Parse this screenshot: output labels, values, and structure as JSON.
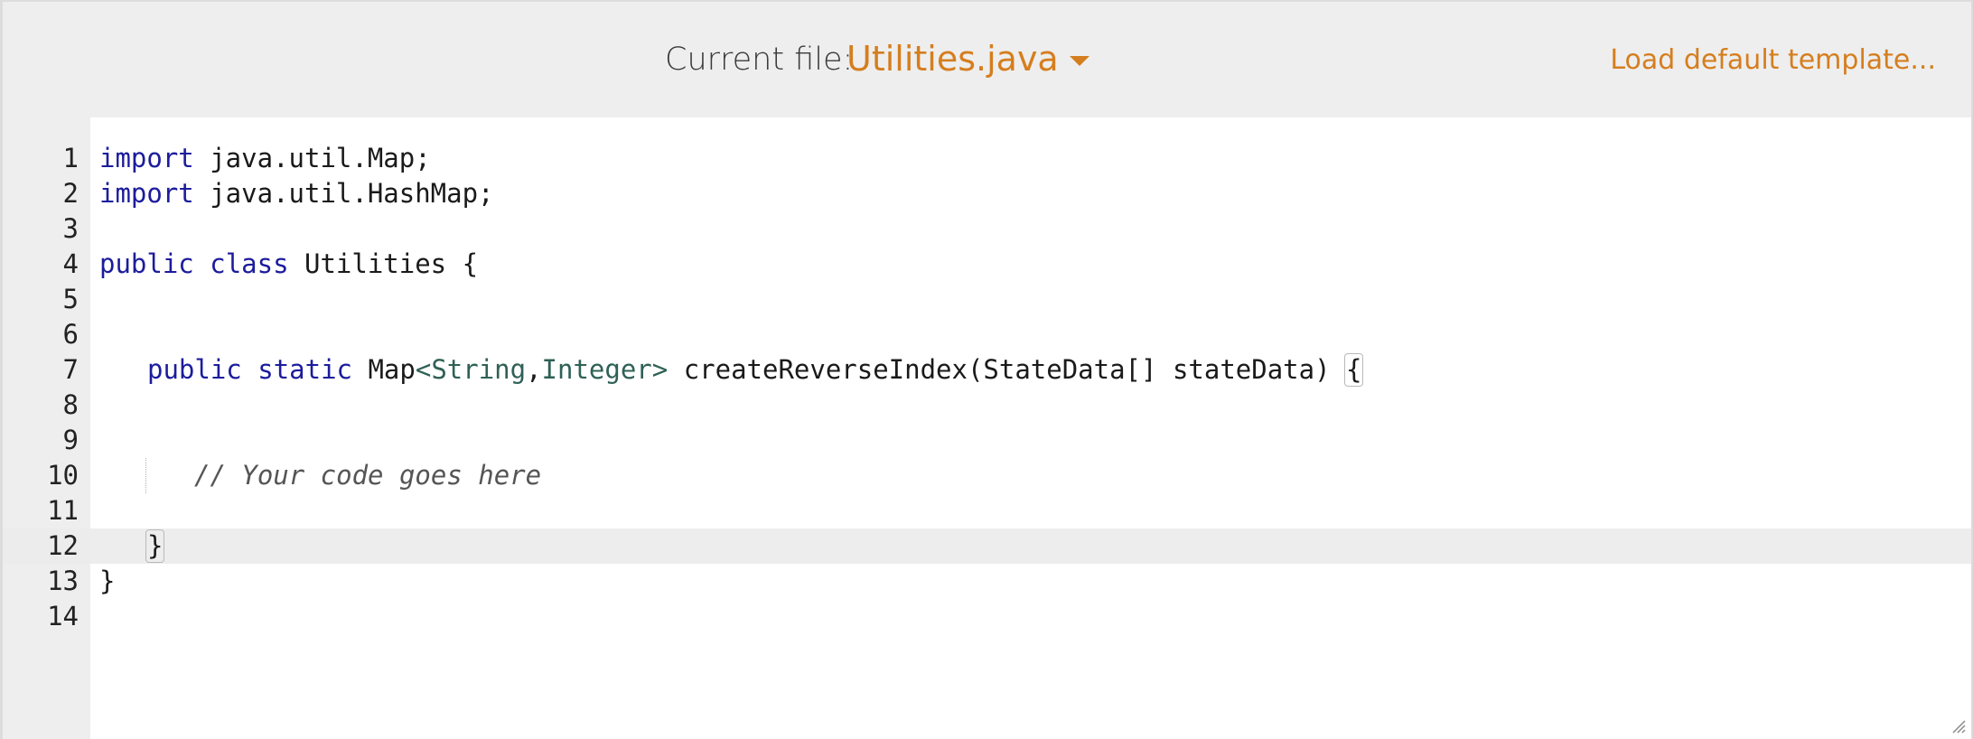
{
  "header": {
    "current_file_label": "Current file:",
    "file_name": "Utilities.java",
    "load_template_label": "Load default template..."
  },
  "editor": {
    "active_line": 12,
    "line_numbers": [
      "1",
      "2",
      "3",
      "4",
      "5",
      "6",
      "7",
      "8",
      "9",
      "10",
      "11",
      "12",
      "13",
      "14"
    ],
    "lines": {
      "l1_kw": "import",
      "l1_rest": " java.util.Map;",
      "l2_kw": "import",
      "l2_rest": " java.util.HashMap;",
      "l4_kw1": "public",
      "l4_kw2": "class",
      "l4_rest": " Utilities {",
      "l7_kw1": "public",
      "l7_kw2": "static",
      "l7_map": " Map",
      "l7_lt": "<",
      "l7_t1": "String",
      "l7_comma": ",",
      "l7_t2": "Integer",
      "l7_gt": ">",
      "l7_rest": " createReverseIndex(StateData[] stateData) ",
      "l7_brace": "{",
      "l10_comment": "// Your code goes here",
      "l12_brace": "}",
      "l13_brace": "}"
    }
  },
  "colors": {
    "accent": "#d57e1e",
    "keyword": "#1c1c9c",
    "type": "#2f6156",
    "gutter_bg": "#eeeeee"
  }
}
